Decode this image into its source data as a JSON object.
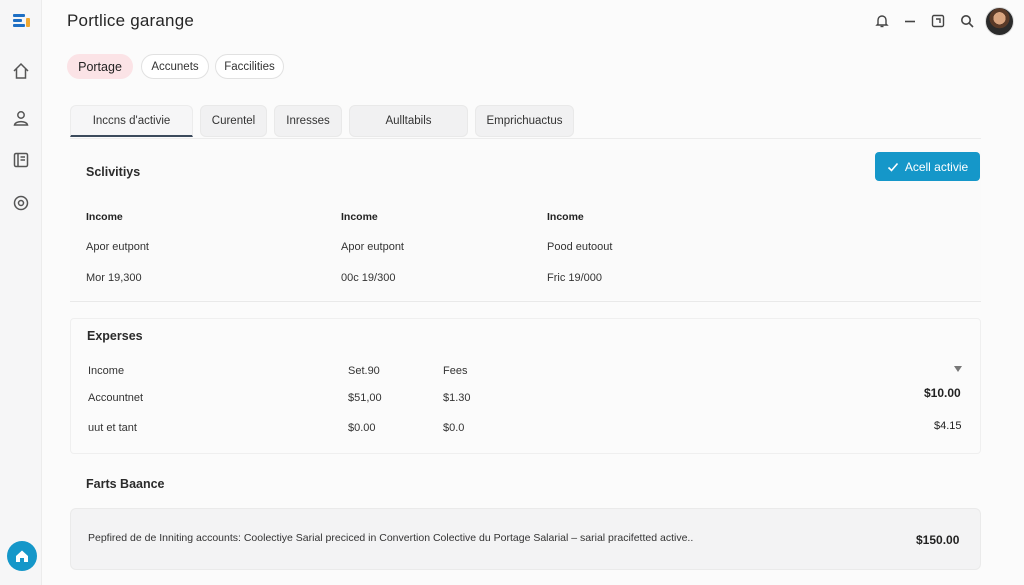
{
  "app": {
    "title": "Portlice garange"
  },
  "rail": {
    "logo_colors": [
      "#1e6fc4",
      "#f0a830",
      "#1e6fc4"
    ],
    "icons": [
      "home-icon",
      "user-icon",
      "ledger-icon",
      "target-icon"
    ],
    "fab_icon": "home-icon",
    "fab_color": "#1597c9"
  },
  "topbar": {
    "icons": [
      "bell-icon",
      "minimize-icon",
      "window-icon",
      "search-icon"
    ]
  },
  "pills": [
    {
      "label": "Portage",
      "active": true
    },
    {
      "label": "Accunets",
      "active": false
    },
    {
      "label": "Faccilities",
      "active": false
    }
  ],
  "tabs": [
    {
      "label": "Inccns d'activie",
      "active": true
    },
    {
      "label": "Curentel",
      "active": false
    },
    {
      "label": "Inresses",
      "active": false
    },
    {
      "label": "Aulltabils",
      "active": false
    },
    {
      "label": "Emprichuactus",
      "active": false
    }
  ],
  "activities": {
    "title": "Sclivitiys",
    "action_label": "Acell activie",
    "columns": [
      {
        "head": "Income",
        "line1": "Apor eutpont",
        "line2": "Mor 19,300"
      },
      {
        "head": "Income",
        "line1": "Apor eutpont",
        "line2": "00c 19/300"
      },
      {
        "head": "Income",
        "line1": "Pood eutoout",
        "line2": "Fric 19/000"
      }
    ]
  },
  "expenses": {
    "title": "Experses",
    "rows": [
      {
        "label": "Income",
        "c1": "Set.90",
        "c2": "Fees",
        "right": ""
      },
      {
        "label": "Accountnet",
        "c1": "$51,00",
        "c2": "$1.30",
        "right": "$10.00"
      },
      {
        "label": "uut et tant",
        "c1": "$0.00",
        "c2": "$0.0",
        "right": "$4.15"
      }
    ]
  },
  "balance": {
    "title": "Farts Baance",
    "text": "Pepfired de de Inniting accounts: Coolectiye Sarial preciced in Convertion Colective du Portage Salarial – sarial pracifetted active..",
    "total": "$150.00"
  },
  "accent": "#1597c9"
}
